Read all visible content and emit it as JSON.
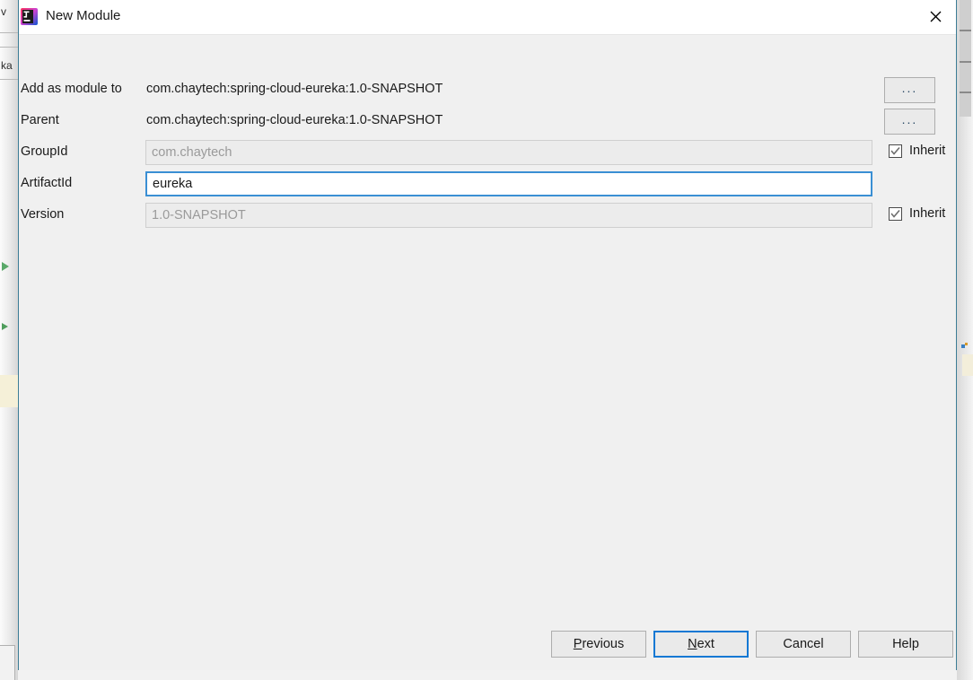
{
  "background": {
    "left_fragment_top": "v",
    "left_fragment_mid": "ka"
  },
  "dialog": {
    "title": "New Module",
    "icon": "intellij-idea-icon",
    "close_icon": "close-icon",
    "rows": [
      {
        "label": "Add as module to",
        "type": "text",
        "value": "com.chaytech:spring-cloud-eureka:1.0-SNAPSHOT",
        "button": "..."
      },
      {
        "label": "Parent",
        "type": "text",
        "value": "com.chaytech:spring-cloud-eureka:1.0-SNAPSHOT",
        "button": "..."
      },
      {
        "label": "GroupId",
        "type": "field",
        "value": "com.chaytech",
        "state": "disabled",
        "inherit": {
          "label": "Inherit",
          "checked": true
        }
      },
      {
        "label": "ArtifactId",
        "type": "field",
        "value": "eureka",
        "state": "focused"
      },
      {
        "label": "Version",
        "type": "field",
        "value": "1.0-SNAPSHOT",
        "state": "disabled",
        "inherit": {
          "label": "Inherit",
          "checked": true
        }
      }
    ],
    "buttons": {
      "previous": {
        "prefix": "P",
        "rest": "revious"
      },
      "next": {
        "prefix": "N",
        "rest": "ext",
        "default": true
      },
      "cancel": "Cancel",
      "help": "Help"
    }
  },
  "colors": {
    "dialog_border": "#3c7d96",
    "focus_blue": "#3a8fd4",
    "default_button_blue": "#1278d4",
    "dialog_bg": "#f0f0f0",
    "titlebar_bg": "#ffffff",
    "disabled_text": "#9a9a9a"
  }
}
